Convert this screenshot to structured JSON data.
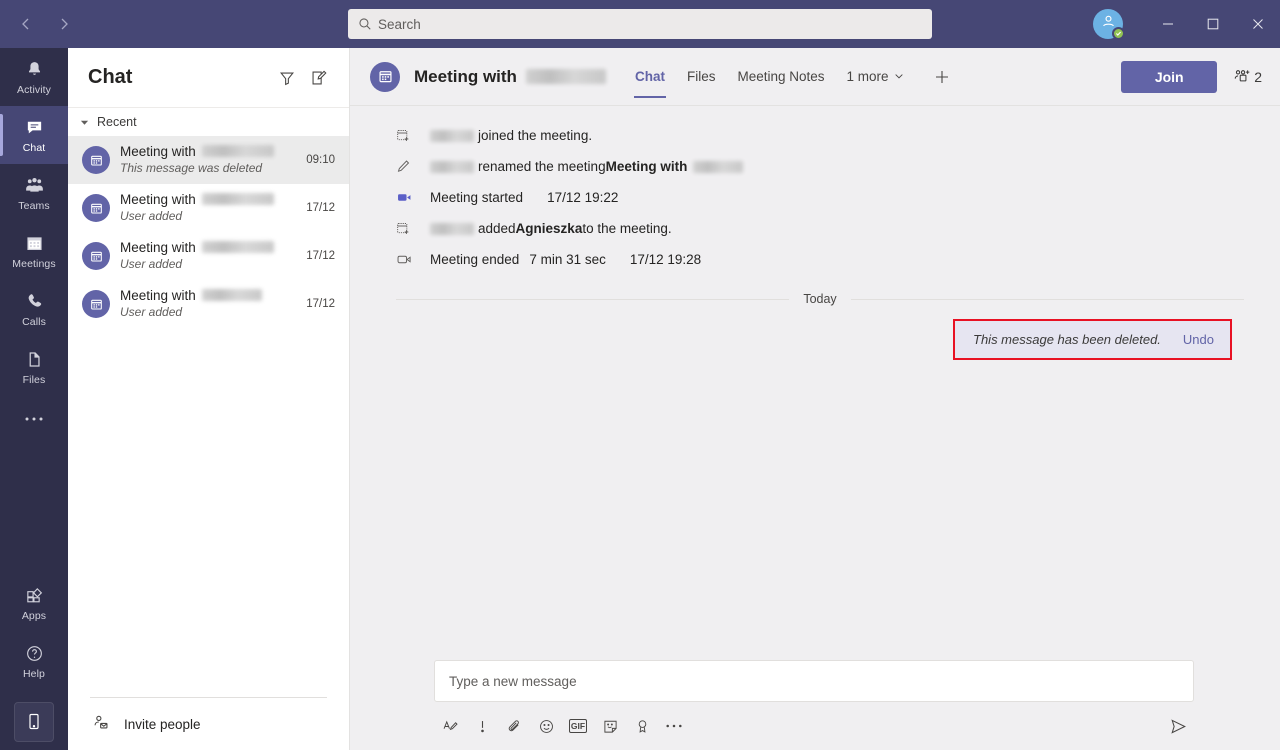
{
  "titlebar": {
    "back_label": "back-arrow",
    "forward_label": "forward-arrow",
    "search_placeholder": "Search",
    "search_value": "",
    "minimize": "minimize",
    "maximize": "maximize",
    "close": "close",
    "presence_status": "Available",
    "accent_color": "#464775"
  },
  "rail": {
    "items": [
      {
        "label": "Activity",
        "icon": "bell-icon",
        "active": false
      },
      {
        "label": "Chat",
        "icon": "chat-icon",
        "active": true
      },
      {
        "label": "Teams",
        "icon": "teams-icon",
        "active": false
      },
      {
        "label": "Meetings",
        "icon": "calendar-icon",
        "active": false
      },
      {
        "label": "Calls",
        "icon": "phone-icon",
        "active": false
      },
      {
        "label": "Files",
        "icon": "file-icon",
        "active": false
      }
    ],
    "more": "...",
    "bottom": [
      {
        "label": "Apps",
        "icon": "apps-icon"
      },
      {
        "label": "Help",
        "icon": "help-icon"
      }
    ],
    "mobile_label": "download-mobile-app",
    "background": "#2f2f4a",
    "active_background": "#464775"
  },
  "chat_list": {
    "title": "Chat",
    "filter_icon": "filter-icon",
    "compose_icon": "compose-icon",
    "group_label": "Recent",
    "items": [
      {
        "title": "Meeting with",
        "redacted_width": 72,
        "subtitle": "This message was deleted",
        "time": "09:10",
        "selected": true
      },
      {
        "title": "Meeting with",
        "redacted_width": 72,
        "subtitle": "User added",
        "time": "17/12",
        "selected": false
      },
      {
        "title": "Meeting with",
        "redacted_width": 72,
        "subtitle": "User added",
        "time": "17/12",
        "selected": false
      },
      {
        "title": "Meeting with",
        "redacted_width": 60,
        "subtitle": "User added",
        "time": "17/12",
        "selected": false
      }
    ],
    "invite_label": "Invite people"
  },
  "conversation": {
    "header": {
      "title": "Meeting with",
      "title_redacted_width": 80,
      "avatar_icon": "calendar-icon",
      "tabs": [
        {
          "label": "Chat",
          "active": true
        },
        {
          "label": "Files",
          "active": false
        },
        {
          "label": "Meeting Notes",
          "active": false
        }
      ],
      "more_tabs_label": "1 more",
      "add_tab_label": "add-tab",
      "join_label": "Join",
      "participants_count": "2"
    },
    "system_messages": [
      {
        "icon": "calendar-add-icon",
        "pre_redacted_width": 48,
        "text": "joined the meeting.",
        "bold_part": "",
        "post_redacted_width": 0,
        "time": "",
        "duration": ""
      },
      {
        "icon": "pencil-icon",
        "pre_redacted_width": 48,
        "text": "renamed the meeting ",
        "bold_part": "Meeting with",
        "post_redacted_width": 52,
        "time": "",
        "duration": ""
      },
      {
        "icon": "video-icon",
        "pre_redacted_width": 0,
        "text": "Meeting started",
        "bold_part": "",
        "post_redacted_width": 0,
        "time": "17/12 19:22",
        "duration": ""
      },
      {
        "icon": "calendar-add-icon",
        "pre_redacted_width": 48,
        "text": "added ",
        "bold_part": "Agnieszka",
        "post_text": " to the meeting.",
        "post_redacted_width": 0,
        "time": "",
        "duration": ""
      },
      {
        "icon": "video-off-icon",
        "pre_redacted_width": 0,
        "text": "Meeting ended",
        "bold_part": "",
        "post_redacted_width": 0,
        "duration": "7 min 31 sec",
        "time": "17/12 19:28"
      }
    ],
    "day_divider": "Today",
    "deleted_message": {
      "text": "This message has been deleted.",
      "undo_label": "Undo",
      "bubble_color": "#e6e5f1",
      "highlight_color": "#e81123",
      "link_color": "#6264a7"
    }
  },
  "composer": {
    "placeholder": "Type a new message",
    "value": "",
    "tools": [
      {
        "name": "format-icon",
        "label": "Format"
      },
      {
        "name": "important-icon",
        "label": "Set delivery options"
      },
      {
        "name": "attach-icon",
        "label": "Attach"
      },
      {
        "name": "emoji-icon",
        "label": "Emoji"
      },
      {
        "name": "gif-icon",
        "label": "GIF"
      },
      {
        "name": "sticker-icon",
        "label": "Sticker"
      },
      {
        "name": "praise-icon",
        "label": "Praise"
      },
      {
        "name": "more-icon",
        "label": "More options"
      }
    ],
    "send_label": "Send"
  }
}
